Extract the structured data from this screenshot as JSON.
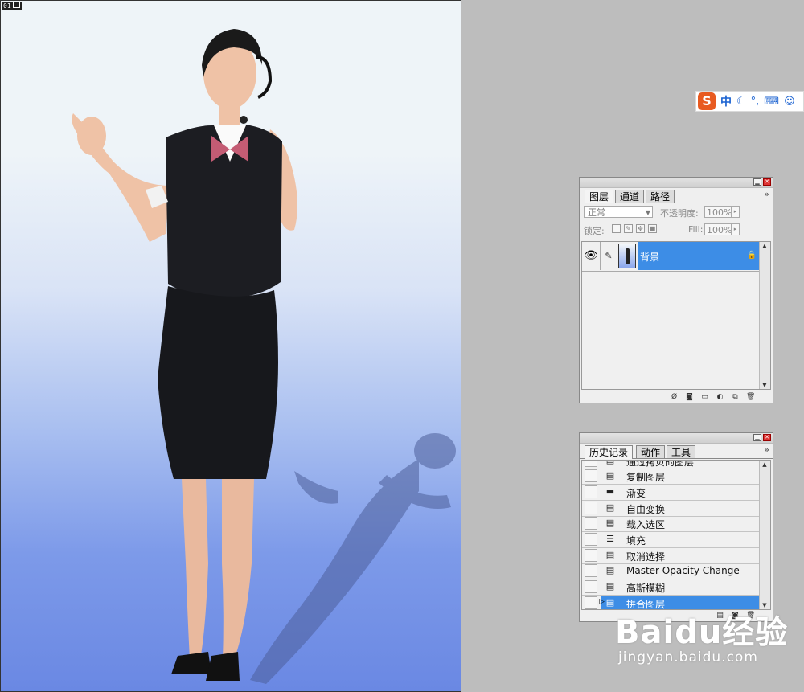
{
  "document": {
    "tag": "01"
  },
  "ime_toolbar": {
    "logo": "S",
    "mode": "中",
    "icons": [
      "moon-icon",
      "punctuation-icon",
      "keyboard-icon",
      "user-icon"
    ]
  },
  "layers_panel": {
    "tabs": [
      {
        "label": "图层",
        "active": true
      },
      {
        "label": "通道",
        "active": false
      },
      {
        "label": "路径",
        "active": false
      }
    ],
    "blend_mode": "正常",
    "opacity_label": "不透明度:",
    "opacity_value": "100%",
    "lock_label": "锁定:",
    "fill_label": "Fill:",
    "fill_value": "100%",
    "layers": [
      {
        "name": "背景",
        "visible": true,
        "locked": true,
        "selected": true
      }
    ]
  },
  "history_panel": {
    "tabs": [
      {
        "label": "历史记录",
        "active": true
      },
      {
        "label": "动作",
        "active": false
      },
      {
        "label": "工具",
        "active": false
      }
    ],
    "items": [
      {
        "label": "通过拷贝的图层",
        "icon": "history-step-icon"
      },
      {
        "label": "复制图层",
        "icon": "history-step-icon"
      },
      {
        "label": "渐变",
        "icon": "gradient-icon"
      },
      {
        "label": "自由变换",
        "icon": "history-step-icon"
      },
      {
        "label": "载入选区",
        "icon": "history-step-icon"
      },
      {
        "label": "填充",
        "icon": "fill-icon"
      },
      {
        "label": "取消选择",
        "icon": "history-step-icon"
      },
      {
        "label": "Master Opacity Change",
        "icon": "history-step-icon"
      },
      {
        "label": "高斯模糊",
        "icon": "history-step-icon"
      },
      {
        "label": "拼合图层",
        "icon": "history-step-icon",
        "active": true
      }
    ]
  },
  "watermark": {
    "logo": "Baidu经验",
    "url": "jingyan.baidu.com"
  }
}
